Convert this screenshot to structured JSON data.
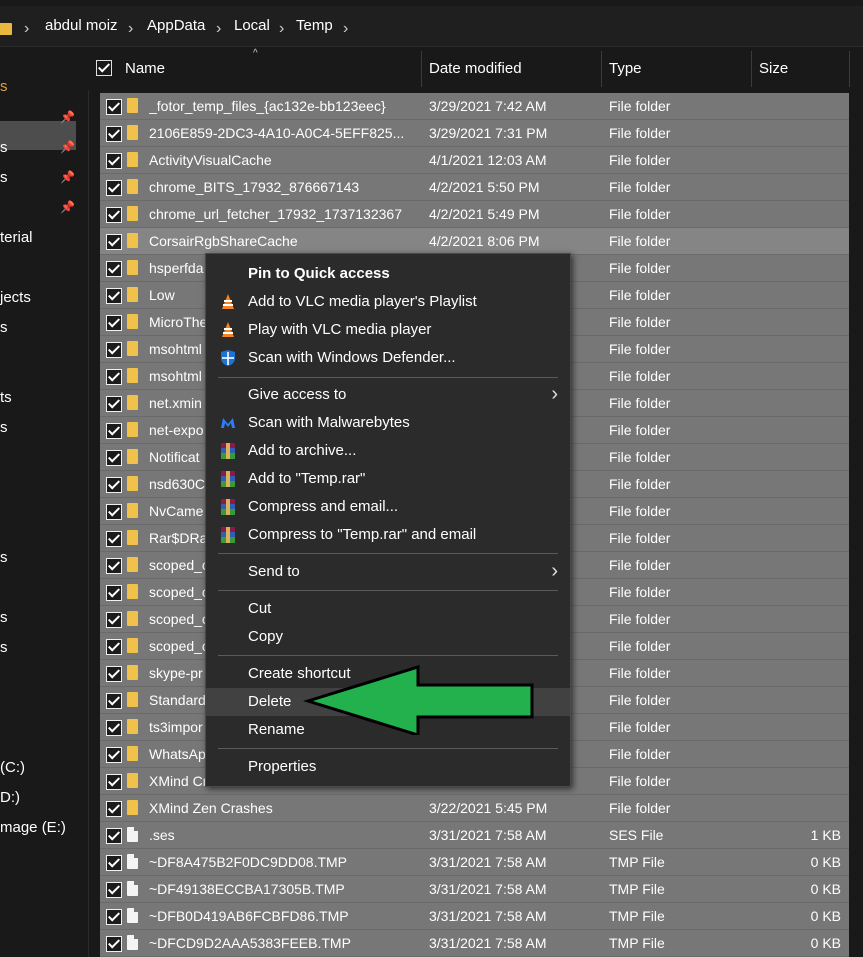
{
  "breadcrumb": [
    "abdul moiz",
    "AppData",
    "Local",
    "Temp"
  ],
  "nav": {
    "items": [
      "s",
      "s",
      "s",
      "terial",
      "jects",
      "s",
      "ts",
      "s",
      "s",
      "s",
      "s",
      "(C:)",
      "D:)",
      "mage (E:)"
    ]
  },
  "columns": {
    "name": "Name",
    "date": "Date modified",
    "type": "Type",
    "size": "Size"
  },
  "files": [
    {
      "name": "_fotor_temp_files_{ac132e-bb123eec}",
      "date": "3/29/2021 7:42 AM",
      "type": "File folder",
      "size": "",
      "kind": "folder"
    },
    {
      "name": "2106E859-2DC3-4A10-A0C4-5EFF825...",
      "date": "3/29/2021 7:31 PM",
      "type": "File folder",
      "size": "",
      "kind": "folder"
    },
    {
      "name": "ActivityVisualCache",
      "date": "4/1/2021 12:03 AM",
      "type": "File folder",
      "size": "",
      "kind": "folder"
    },
    {
      "name": "chrome_BITS_17932_876667143",
      "date": "4/2/2021 5:50 PM",
      "type": "File folder",
      "size": "",
      "kind": "folder"
    },
    {
      "name": "chrome_url_fetcher_17932_1737132367",
      "date": "4/2/2021 5:49 PM",
      "type": "File folder",
      "size": "",
      "kind": "folder"
    },
    {
      "name": "CorsairRgbShareCache",
      "date": "4/2/2021 8:06 PM",
      "type": "File folder",
      "size": "",
      "kind": "folder"
    },
    {
      "name": "hsperfda",
      "date": "",
      "type": "File folder",
      "size": "",
      "kind": "folder"
    },
    {
      "name": "Low",
      "date": "",
      "type": "File folder",
      "size": "",
      "kind": "folder"
    },
    {
      "name": "MicroThe",
      "date": "",
      "type": "File folder",
      "size": "",
      "kind": "folder"
    },
    {
      "name": "msohtml",
      "date": "",
      "type": "File folder",
      "size": "",
      "kind": "folder"
    },
    {
      "name": "msohtml",
      "date": "",
      "type": "File folder",
      "size": "",
      "kind": "folder"
    },
    {
      "name": "net.xmin",
      "date": "",
      "type": "File folder",
      "size": "",
      "kind": "folder"
    },
    {
      "name": "net-expo",
      "date": "",
      "type": "File folder",
      "size": "",
      "kind": "folder"
    },
    {
      "name": "Notificat",
      "date": "",
      "type": "File folder",
      "size": "",
      "kind": "folder"
    },
    {
      "name": "nsd630C",
      "date": "",
      "type": "File folder",
      "size": "",
      "kind": "folder"
    },
    {
      "name": "NvCame",
      "date": "",
      "type": "File folder",
      "size": "",
      "kind": "folder"
    },
    {
      "name": "Rar$DRa",
      "date": "",
      "type": "File folder",
      "size": "",
      "kind": "folder"
    },
    {
      "name": "scoped_c",
      "date": "",
      "type": "File folder",
      "size": "",
      "kind": "folder"
    },
    {
      "name": "scoped_c",
      "date": "",
      "type": "File folder",
      "size": "",
      "kind": "folder"
    },
    {
      "name": "scoped_c",
      "date": "",
      "type": "File folder",
      "size": "",
      "kind": "folder"
    },
    {
      "name": "scoped_c",
      "date": "",
      "type": "File folder",
      "size": "",
      "kind": "folder"
    },
    {
      "name": "skype-pr",
      "date": "",
      "type": "File folder",
      "size": "",
      "kind": "folder"
    },
    {
      "name": "Standard",
      "date": "",
      "type": "File folder",
      "size": "",
      "kind": "folder"
    },
    {
      "name": "ts3impor",
      "date": "",
      "type": "File folder",
      "size": "",
      "kind": "folder"
    },
    {
      "name": "WhatsAp",
      "date": "",
      "type": "File folder",
      "size": "",
      "kind": "folder"
    },
    {
      "name": "XMind Crashes",
      "date": "",
      "type": "File folder",
      "size": "",
      "kind": "folder"
    },
    {
      "name": "XMind Zen Crashes",
      "date": "3/22/2021 5:45 PM",
      "type": "File folder",
      "size": "",
      "kind": "folder"
    },
    {
      "name": ".ses",
      "date": "3/31/2021 7:58 AM",
      "type": "SES File",
      "size": "1 KB",
      "kind": "file"
    },
    {
      "name": "~DF8A475B2F0DC9DD08.TMP",
      "date": "3/31/2021 7:58 AM",
      "type": "TMP File",
      "size": "0 KB",
      "kind": "file"
    },
    {
      "name": "~DF49138ECCBA17305B.TMP",
      "date": "3/31/2021 7:58 AM",
      "type": "TMP File",
      "size": "0 KB",
      "kind": "file"
    },
    {
      "name": "~DFB0D419AB6FCBFD86.TMP",
      "date": "3/31/2021 7:58 AM",
      "type": "TMP File",
      "size": "0 KB",
      "kind": "file"
    },
    {
      "name": "~DFCD9D2AAA5383FEEB.TMP",
      "date": "3/31/2021 7:58 AM",
      "type": "TMP File",
      "size": "0 KB",
      "kind": "file"
    }
  ],
  "menu": {
    "pin": "Pin to Quick access",
    "vlc_playlist": "Add to VLC media player's Playlist",
    "vlc_play": "Play with VLC media player",
    "defender": "Scan with Windows Defender...",
    "give_access": "Give access to",
    "malwarebytes": "Scan with Malwarebytes",
    "add_archive": "Add to archive...",
    "add_rar": "Add to \"Temp.rar\"",
    "compress_email": "Compress and email...",
    "compress_rar_email": "Compress to \"Temp.rar\" and email",
    "send_to": "Send to",
    "cut": "Cut",
    "copy": "Copy",
    "create_shortcut": "Create shortcut",
    "delete": "Delete",
    "rename": "Rename",
    "properties": "Properties"
  },
  "colors": {
    "arrow": "#22b14c",
    "folder": "#f0c14b",
    "row": "#777777",
    "menu": "#2b2b2b"
  }
}
